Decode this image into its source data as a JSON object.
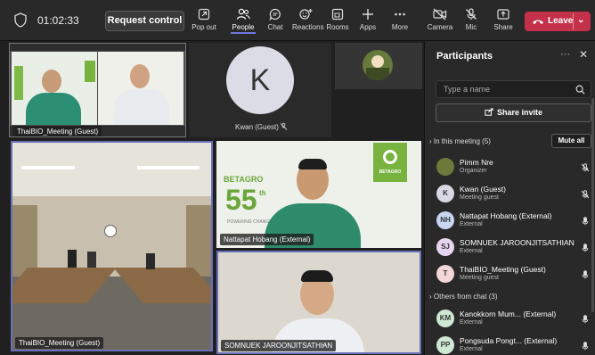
{
  "toolbar": {
    "timer": "01:02:33",
    "request_control": "Request control",
    "tools": [
      {
        "label": "Pop out",
        "icon": "pop-out-icon"
      },
      {
        "label": "People",
        "icon": "people-icon"
      },
      {
        "label": "Chat",
        "icon": "chat-icon"
      },
      {
        "label": "Reactions",
        "icon": "reactions-icon"
      },
      {
        "label": "Rooms",
        "icon": "rooms-icon"
      },
      {
        "label": "Apps",
        "icon": "apps-icon"
      },
      {
        "label": "More",
        "icon": "more-icon"
      },
      {
        "label": "Camera",
        "icon": "camera-off-icon"
      },
      {
        "label": "Mic",
        "icon": "mic-off-icon"
      },
      {
        "label": "Share",
        "icon": "share-icon"
      }
    ],
    "leave": "Leave"
  },
  "stage": {
    "tiles": [
      {
        "name": "ThaiBIO_Meeting (Guest)"
      },
      {
        "name": "Kwan (Guest)",
        "initial": "K"
      },
      {
        "name": "ThaiBIO_Meeting (Guest)"
      },
      {
        "name": "Nattapat Hobang (External)",
        "logo_text": "BETAGRO",
        "logo_badge": "BETAGRO",
        "anniv": "55",
        "anniv_sup": "th",
        "tagline": "POWERING CHANGE"
      },
      {
        "name": "SOMNUEK JAROONJITSATHIAN",
        "more": "···"
      }
    ]
  },
  "panel": {
    "title": "Participants",
    "search_placeholder": "Type a name",
    "share_invite": "Share invite",
    "in_meeting": "In this meeting (5)",
    "mute_all": "Mute all",
    "others": "Others from chat (3)",
    "participants": [
      {
        "name": "Pimm Nre",
        "role": "Organizer",
        "initials": "",
        "color": "#6b7a3a"
      },
      {
        "name": "Kwan (Guest)",
        "role": "Meeting guest",
        "initials": "K",
        "color": "#d9d9e6"
      },
      {
        "name": "Nattapat Hobang (External)",
        "role": "External",
        "initials": "NH",
        "color": "#c9d6f2"
      },
      {
        "name": "SOMNUEK JAROONJITSATHIAN",
        "role": "External",
        "initials": "SJ",
        "color": "#e6d5f0"
      },
      {
        "name": "ThaiBIO_Meeting (Guest)",
        "role": "Meeting guest",
        "initials": "T",
        "color": "#f3d6d6"
      }
    ],
    "others_list": [
      {
        "name": "Kanokkorn Mum... (External)",
        "role": "External",
        "initials": "KM",
        "color": "#cfe8d4"
      },
      {
        "name": "Pongsuda Pongt... (External)",
        "role": "External",
        "initials": "PP",
        "color": "#cfe8d4"
      }
    ]
  }
}
